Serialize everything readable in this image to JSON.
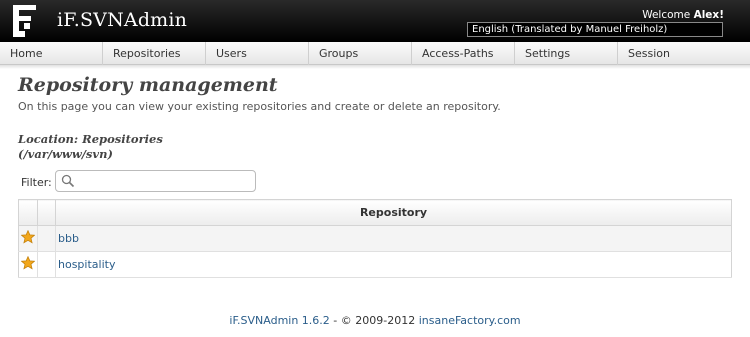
{
  "header": {
    "app_title": "iF.SVNAdmin",
    "welcome_prefix": "Welcome ",
    "username": "Alex!",
    "language": "English (Translated by Manuel Freiholz)"
  },
  "nav": {
    "items": [
      {
        "label": "Home"
      },
      {
        "label": "Repositories"
      },
      {
        "label": "Users"
      },
      {
        "label": "Groups"
      },
      {
        "label": "Access-Paths"
      },
      {
        "label": "Settings"
      },
      {
        "label": "Session"
      }
    ]
  },
  "main": {
    "title": "Repository management",
    "description": "On this page you can view your existing repositories and create or delete an repository.",
    "location_line1": "Location: Repositories",
    "location_line2": "(/var/www/svn)",
    "filter_label": "Filter:",
    "filter_value": "",
    "table": {
      "column_header": "Repository",
      "rows": [
        {
          "name": "bbb"
        },
        {
          "name": "hospitality"
        }
      ]
    }
  },
  "footer": {
    "app_link": "iF.SVNAdmin 1.6.2",
    "separator": " - © 2009-2012 ",
    "company_link": "insaneFactory.com"
  },
  "colors": {
    "header_bg": "#000000",
    "link": "#2a5d8a",
    "star": "#f2a71b"
  }
}
